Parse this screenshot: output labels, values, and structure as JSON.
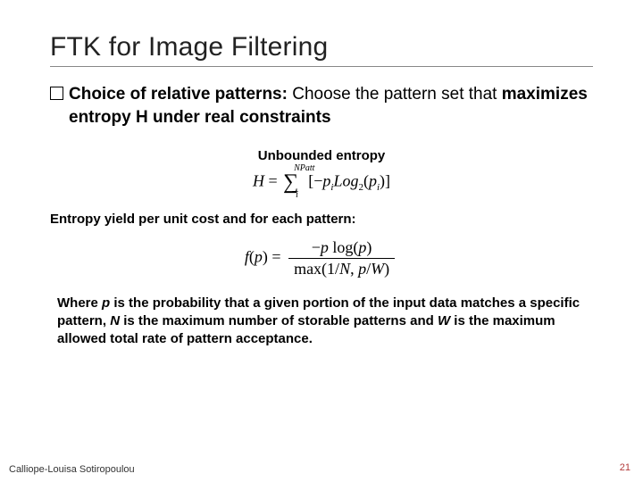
{
  "title": "FTK for Image Filtering",
  "bullet": {
    "lead": "Choice of relative patterns:",
    "rest_a": " Choose the pattern set that ",
    "rest_b": "maximizes entropy H under real constraints"
  },
  "label_unbounded": "Unbounded entropy",
  "formula1": {
    "H": "H",
    "eq": " = ",
    "sum_upper": "NPatt",
    "sum_lower": "i",
    "body_open": "[−",
    "p": "p",
    "i1": "i",
    "log": "Log",
    "base": "2",
    "lp": "(",
    "p2": "p",
    "i2": "i",
    "rp": ")]"
  },
  "para_yield": "Entropy yield per unit cost and for each pattern:",
  "formula2": {
    "f": "f",
    "lp": "(",
    "p": "p",
    "rp": ") = ",
    "num_a": "−",
    "num_p": "p",
    "num_sp": " ",
    "num_log": "log",
    "num_lp": "(",
    "num_p2": "p",
    "num_rp": ")",
    "den_a": "max(1/",
    "den_N": "N",
    "den_b": ", ",
    "den_p": "p",
    "den_c": "/",
    "den_W": "W",
    "den_d": ")"
  },
  "para_where": {
    "a": "Where ",
    "p": "p",
    "b": " is the probability that a given portion of the input data matches a specific pattern, ",
    "N": "N",
    "c": " is the maximum number of storable patterns and ",
    "W": "W",
    "d": " is the maximum allowed total rate of pattern acceptance."
  },
  "footer": {
    "author": "Calliope-Louisa Sotiropoulou",
    "page": "21"
  }
}
